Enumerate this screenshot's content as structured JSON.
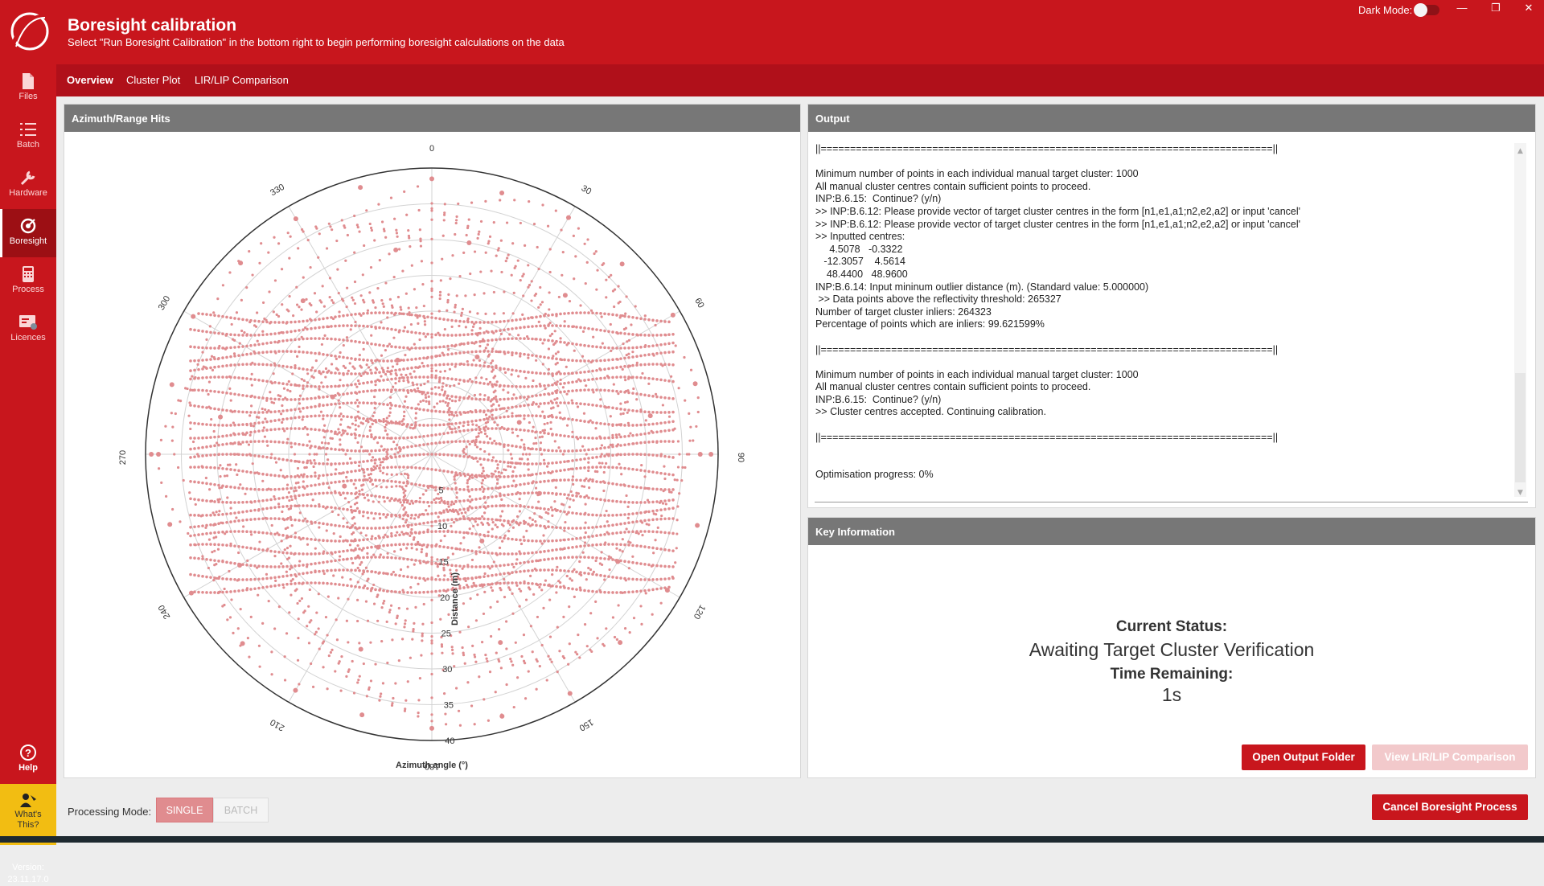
{
  "app": {
    "title": "Boresight calibration",
    "subtitle": "Select \"Run Boresight Calibration\" in the bottom right to begin performing boresight calculations on the data",
    "dark_mode_label": "Dark Mode:",
    "dark_mode": false
  },
  "sidebar": {
    "items": [
      {
        "label": "Files",
        "icon": "file-icon"
      },
      {
        "label": "Batch",
        "icon": "list-icon"
      },
      {
        "label": "Hardware",
        "icon": "wrench-icon"
      },
      {
        "label": "Boresight",
        "icon": "target-icon",
        "active": true
      },
      {
        "label": "Process",
        "icon": "calculator-icon"
      },
      {
        "label": "Licences",
        "icon": "licence-icon"
      }
    ],
    "help": "Help",
    "whats_this": "What's This?",
    "version_label": "Version:",
    "version": "23.11.17.0"
  },
  "nav": {
    "tabs": [
      "Overview",
      "Cluster Plot",
      "LIR/LIP Comparison"
    ]
  },
  "chart_panel": {
    "title": "Azimuth/Range Hits"
  },
  "chart_data": {
    "type": "scatter",
    "projection": "polar",
    "xlabel": "Azimuth angle (°)",
    "ylabel": "Distance (m)",
    "angle_ticks": [
      "0",
      "30",
      "60",
      "90",
      "120",
      "150",
      "180",
      "210",
      "240",
      "270",
      "300",
      "330"
    ],
    "radial_ticks": [
      "5",
      "10",
      "15",
      "20",
      "25",
      "30",
      "35",
      "40"
    ],
    "rlim": [
      0,
      40
    ],
    "theta_zero": "top",
    "theta_direction": "clockwise",
    "grid": true,
    "color": "#e08c8f",
    "series": [
      {
        "points": [
          [
            0,
            38.5
          ],
          [
            15,
            37.8
          ],
          [
            30,
            38.2
          ],
          [
            45,
            37.6
          ],
          [
            60,
            38.9
          ],
          [
            75,
            38.1
          ],
          [
            90,
            37.5
          ],
          [
            105,
            38.4
          ],
          [
            120,
            38.0
          ],
          [
            135,
            37.2
          ],
          [
            150,
            38.6
          ],
          [
            165,
            37.9
          ],
          [
            180,
            38.3
          ],
          [
            195,
            37.7
          ],
          [
            210,
            38.1
          ],
          [
            225,
            37.4
          ],
          [
            240,
            38.8
          ],
          [
            255,
            37.9
          ],
          [
            270,
            38.2
          ],
          [
            285,
            37.6
          ],
          [
            300,
            38.5
          ],
          [
            315,
            37.8
          ],
          [
            330,
            38.0
          ],
          [
            345,
            38.6
          ],
          [
            270,
            39.2
          ],
          [
            90,
            39.0
          ],
          [
            10,
            30
          ],
          [
            40,
            29
          ],
          [
            80,
            31
          ],
          [
            120,
            30
          ],
          [
            160,
            28
          ],
          [
            200,
            29
          ],
          [
            240,
            31
          ],
          [
            280,
            30
          ],
          [
            320,
            28
          ],
          [
            350,
            29
          ],
          [
            25,
            15
          ],
          [
            70,
            13
          ],
          [
            110,
            16
          ],
          [
            150,
            14
          ],
          [
            210,
            15
          ],
          [
            250,
            13
          ],
          [
            300,
            16
          ],
          [
            340,
            14
          ]
        ]
      }
    ]
  },
  "output": {
    "title": "Output",
    "lines": [
      "||=============================================================================||",
      "",
      "Minimum number of points in each individual manual target cluster: 1000",
      "All manual cluster centres contain sufficient points to proceed.",
      "INP:B.6.15:  Continue? (y/n)",
      ">> INP:B.6.12: Please provide vector of target cluster centres in the form [n1,e1,a1;n2,e2,a2] or input 'cancel'",
      ">> INP:B.6.12: Please provide vector of target cluster centres in the form [n1,e1,a1;n2,e2,a2] or input 'cancel'",
      ">> Inputted centres:",
      "     4.5078   -0.3322",
      "   -12.3057    4.5614",
      "    48.4400   48.9600",
      "INP:B.6.14: Input mininum outlier distance (m). (Standard value: 5.000000)",
      " >> Data points above the reflectivity threshold: 265327",
      "Number of target cluster inliers: 264323",
      "Percentage of points which are inliers: 99.621599%",
      "",
      "||=============================================================================||",
      "",
      "Minimum number of points in each individual manual target cluster: 1000",
      "All manual cluster centres contain sufficient points to proceed.",
      "INP:B.6.15:  Continue? (y/n)",
      ">> Cluster centres accepted. Continuing calibration.",
      "",
      "||=============================================================================||",
      "",
      "",
      "Optimisation progress: 0%"
    ]
  },
  "key_info": {
    "title": "Key Information",
    "status_label": "Current Status:",
    "status": "Awaiting Target Cluster Verification",
    "time_label": "Time Remaining:",
    "time": "1s",
    "open_folder": "Open Output Folder",
    "view_lir": "View LIR/LIP Comparison"
  },
  "footer": {
    "mode_label": "Processing Mode:",
    "single": "SINGLE",
    "batch": "BATCH",
    "selected": "SINGLE",
    "cancel": "Cancel Boresight Process"
  }
}
